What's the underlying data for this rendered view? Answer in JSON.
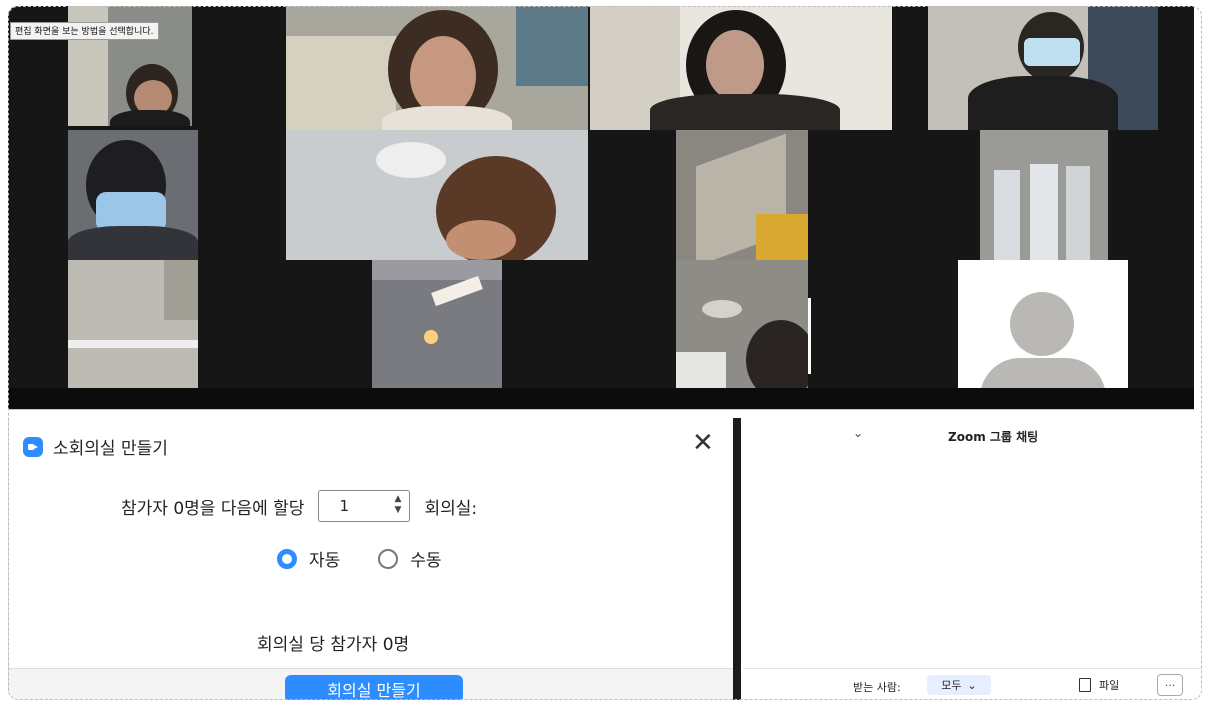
{
  "gallery": {
    "tooltip": "편집 화면을 보는 방법을 선택합니다."
  },
  "breakout": {
    "title": "소회의실 만들기",
    "close_symbol": "✕",
    "assign_prefix": "참가자 0명을 다음에 할당",
    "room_count": "1",
    "assign_suffix": "회의실:",
    "radio_auto": "자동",
    "radio_manual": "수동",
    "per_room": "회의실 당 참가자 0명",
    "create_button": "회의실 만들기"
  },
  "chat": {
    "chevron": "⌄",
    "title": "Zoom 그룹 채팅",
    "to_label": "받는 사람:",
    "to_value": "모두",
    "to_chevron": "⌄",
    "file_label": "파일",
    "more_label": "···"
  },
  "colors": {
    "accent": "#2d8cff",
    "gallery_bg": "#161616"
  },
  "icons": {
    "breakout_icon": "video-camera-icon",
    "close": "close-icon",
    "file": "file-icon",
    "more": "more-icon"
  }
}
